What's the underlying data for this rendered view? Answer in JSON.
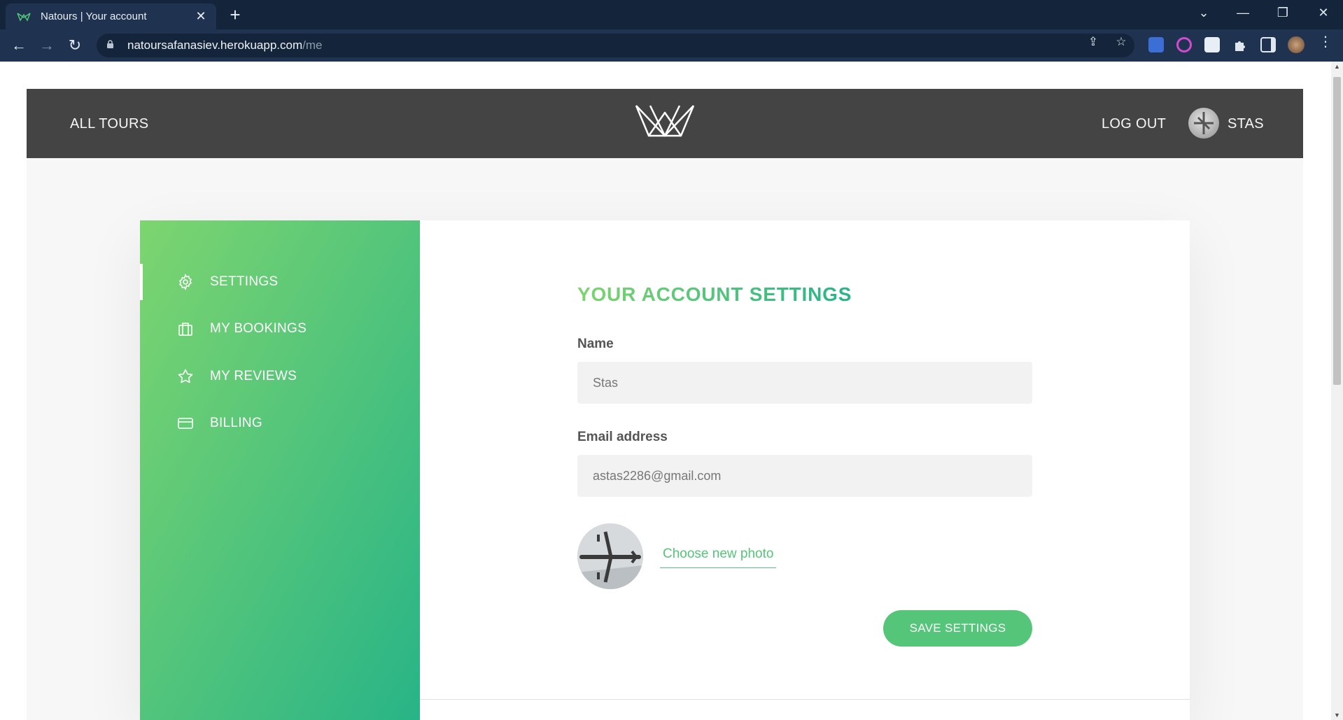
{
  "browser": {
    "tab_title": "Natours | Your account",
    "tab_close": "✕",
    "new_tab": "+",
    "url_host": "natoursafanasiev.herokuapp.com",
    "url_path": "/me",
    "back": "←",
    "forward": "→",
    "reload": "↻",
    "share_icon": "⇪",
    "star_icon": "☆",
    "tab_list": "⌄",
    "minimize": "—",
    "restore": "❐",
    "close": "✕"
  },
  "header": {
    "all_tours": "ALL TOURS",
    "log_out": "LOG OUT",
    "user_name": "STAS"
  },
  "sidebar": {
    "items": [
      {
        "label": "SETTINGS",
        "icon": "settings-icon",
        "active": true
      },
      {
        "label": "MY BOOKINGS",
        "icon": "briefcase-icon",
        "active": false
      },
      {
        "label": "MY REVIEWS",
        "icon": "star-icon",
        "active": false
      },
      {
        "label": "BILLING",
        "icon": "credit-card-icon",
        "active": false
      }
    ]
  },
  "settings": {
    "heading": "YOUR ACCOUNT SETTINGS",
    "name_label": "Name",
    "name_value": "Stas",
    "email_label": "Email address",
    "email_value": "astas2286@gmail.com",
    "choose_photo": "Choose new photo",
    "save_button": "SAVE SETTINGS"
  },
  "colors": {
    "accent": "#55c57a",
    "gradient_start": "#7dd56f",
    "gradient_end": "#28b487",
    "header_bg": "#444444"
  }
}
